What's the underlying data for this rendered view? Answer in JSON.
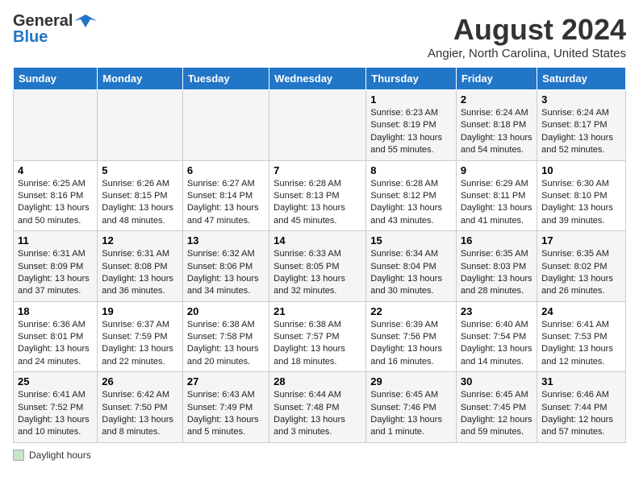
{
  "logo": {
    "line1": "General",
    "line2": "Blue"
  },
  "title": "August 2024",
  "subtitle": "Angier, North Carolina, United States",
  "header_days": [
    "Sunday",
    "Monday",
    "Tuesday",
    "Wednesday",
    "Thursday",
    "Friday",
    "Saturday"
  ],
  "legend_label": "Daylight hours",
  "weeks": [
    [
      {
        "num": "",
        "sunrise": "",
        "sunset": "",
        "daylight": ""
      },
      {
        "num": "",
        "sunrise": "",
        "sunset": "",
        "daylight": ""
      },
      {
        "num": "",
        "sunrise": "",
        "sunset": "",
        "daylight": ""
      },
      {
        "num": "",
        "sunrise": "",
        "sunset": "",
        "daylight": ""
      },
      {
        "num": "1",
        "sunrise": "Sunrise: 6:23 AM",
        "sunset": "Sunset: 8:19 PM",
        "daylight": "Daylight: 13 hours and 55 minutes."
      },
      {
        "num": "2",
        "sunrise": "Sunrise: 6:24 AM",
        "sunset": "Sunset: 8:18 PM",
        "daylight": "Daylight: 13 hours and 54 minutes."
      },
      {
        "num": "3",
        "sunrise": "Sunrise: 6:24 AM",
        "sunset": "Sunset: 8:17 PM",
        "daylight": "Daylight: 13 hours and 52 minutes."
      }
    ],
    [
      {
        "num": "4",
        "sunrise": "Sunrise: 6:25 AM",
        "sunset": "Sunset: 8:16 PM",
        "daylight": "Daylight: 13 hours and 50 minutes."
      },
      {
        "num": "5",
        "sunrise": "Sunrise: 6:26 AM",
        "sunset": "Sunset: 8:15 PM",
        "daylight": "Daylight: 13 hours and 48 minutes."
      },
      {
        "num": "6",
        "sunrise": "Sunrise: 6:27 AM",
        "sunset": "Sunset: 8:14 PM",
        "daylight": "Daylight: 13 hours and 47 minutes."
      },
      {
        "num": "7",
        "sunrise": "Sunrise: 6:28 AM",
        "sunset": "Sunset: 8:13 PM",
        "daylight": "Daylight: 13 hours and 45 minutes."
      },
      {
        "num": "8",
        "sunrise": "Sunrise: 6:28 AM",
        "sunset": "Sunset: 8:12 PM",
        "daylight": "Daylight: 13 hours and 43 minutes."
      },
      {
        "num": "9",
        "sunrise": "Sunrise: 6:29 AM",
        "sunset": "Sunset: 8:11 PM",
        "daylight": "Daylight: 13 hours and 41 minutes."
      },
      {
        "num": "10",
        "sunrise": "Sunrise: 6:30 AM",
        "sunset": "Sunset: 8:10 PM",
        "daylight": "Daylight: 13 hours and 39 minutes."
      }
    ],
    [
      {
        "num": "11",
        "sunrise": "Sunrise: 6:31 AM",
        "sunset": "Sunset: 8:09 PM",
        "daylight": "Daylight: 13 hours and 37 minutes."
      },
      {
        "num": "12",
        "sunrise": "Sunrise: 6:31 AM",
        "sunset": "Sunset: 8:08 PM",
        "daylight": "Daylight: 13 hours and 36 minutes."
      },
      {
        "num": "13",
        "sunrise": "Sunrise: 6:32 AM",
        "sunset": "Sunset: 8:06 PM",
        "daylight": "Daylight: 13 hours and 34 minutes."
      },
      {
        "num": "14",
        "sunrise": "Sunrise: 6:33 AM",
        "sunset": "Sunset: 8:05 PM",
        "daylight": "Daylight: 13 hours and 32 minutes."
      },
      {
        "num": "15",
        "sunrise": "Sunrise: 6:34 AM",
        "sunset": "Sunset: 8:04 PM",
        "daylight": "Daylight: 13 hours and 30 minutes."
      },
      {
        "num": "16",
        "sunrise": "Sunrise: 6:35 AM",
        "sunset": "Sunset: 8:03 PM",
        "daylight": "Daylight: 13 hours and 28 minutes."
      },
      {
        "num": "17",
        "sunrise": "Sunrise: 6:35 AM",
        "sunset": "Sunset: 8:02 PM",
        "daylight": "Daylight: 13 hours and 26 minutes."
      }
    ],
    [
      {
        "num": "18",
        "sunrise": "Sunrise: 6:36 AM",
        "sunset": "Sunset: 8:01 PM",
        "daylight": "Daylight: 13 hours and 24 minutes."
      },
      {
        "num": "19",
        "sunrise": "Sunrise: 6:37 AM",
        "sunset": "Sunset: 7:59 PM",
        "daylight": "Daylight: 13 hours and 22 minutes."
      },
      {
        "num": "20",
        "sunrise": "Sunrise: 6:38 AM",
        "sunset": "Sunset: 7:58 PM",
        "daylight": "Daylight: 13 hours and 20 minutes."
      },
      {
        "num": "21",
        "sunrise": "Sunrise: 6:38 AM",
        "sunset": "Sunset: 7:57 PM",
        "daylight": "Daylight: 13 hours and 18 minutes."
      },
      {
        "num": "22",
        "sunrise": "Sunrise: 6:39 AM",
        "sunset": "Sunset: 7:56 PM",
        "daylight": "Daylight: 13 hours and 16 minutes."
      },
      {
        "num": "23",
        "sunrise": "Sunrise: 6:40 AM",
        "sunset": "Sunset: 7:54 PM",
        "daylight": "Daylight: 13 hours and 14 minutes."
      },
      {
        "num": "24",
        "sunrise": "Sunrise: 6:41 AM",
        "sunset": "Sunset: 7:53 PM",
        "daylight": "Daylight: 13 hours and 12 minutes."
      }
    ],
    [
      {
        "num": "25",
        "sunrise": "Sunrise: 6:41 AM",
        "sunset": "Sunset: 7:52 PM",
        "daylight": "Daylight: 13 hours and 10 minutes."
      },
      {
        "num": "26",
        "sunrise": "Sunrise: 6:42 AM",
        "sunset": "Sunset: 7:50 PM",
        "daylight": "Daylight: 13 hours and 8 minutes."
      },
      {
        "num": "27",
        "sunrise": "Sunrise: 6:43 AM",
        "sunset": "Sunset: 7:49 PM",
        "daylight": "Daylight: 13 hours and 5 minutes."
      },
      {
        "num": "28",
        "sunrise": "Sunrise: 6:44 AM",
        "sunset": "Sunset: 7:48 PM",
        "daylight": "Daylight: 13 hours and 3 minutes."
      },
      {
        "num": "29",
        "sunrise": "Sunrise: 6:45 AM",
        "sunset": "Sunset: 7:46 PM",
        "daylight": "Daylight: 13 hours and 1 minute."
      },
      {
        "num": "30",
        "sunrise": "Sunrise: 6:45 AM",
        "sunset": "Sunset: 7:45 PM",
        "daylight": "Daylight: 12 hours and 59 minutes."
      },
      {
        "num": "31",
        "sunrise": "Sunrise: 6:46 AM",
        "sunset": "Sunset: 7:44 PM",
        "daylight": "Daylight: 12 hours and 57 minutes."
      }
    ]
  ]
}
